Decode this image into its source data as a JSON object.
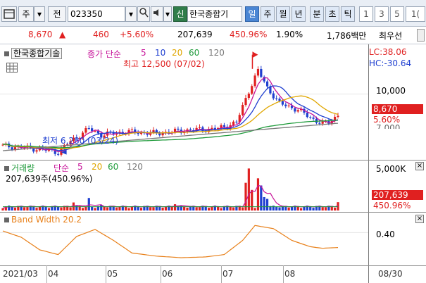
{
  "toolbar": {
    "mode_jong": "주",
    "prev_label": "전",
    "code": "023350",
    "sin_label": "신",
    "stock_name": "한국종합기",
    "periods": [
      "일",
      "주",
      "월",
      "년",
      "분",
      "초",
      "틱"
    ],
    "intervals": [
      "1",
      "3",
      "5",
      "1("
    ]
  },
  "quote": {
    "price": "8,670",
    "change": "460",
    "change_pct": "+5.60%",
    "volume": "207,639",
    "vol_ratio": "450.96%",
    "turnover": "1.90%",
    "amount": "1,786백만",
    "priority": "최우선"
  },
  "price_pane": {
    "title": "한국종합기술",
    "indicator_label": "종가 단순",
    "ma_periods": [
      "5",
      "10",
      "20",
      "60",
      "120"
    ],
    "high_note": "최고 12,500 (07/02)",
    "low_note": "최저 6,280 (03/24)",
    "lc": "LC:38.06",
    "hc": "HC:-30.64",
    "axis_tick": "10,000",
    "price_box": "8,670",
    "pct_box": "5.60%",
    "lower_tick": "7,000"
  },
  "volume_pane": {
    "title": "거래량",
    "ma_label": "단순",
    "ma_periods": [
      "5",
      "20",
      "60",
      "120"
    ],
    "summary": "207,639주(450.96%)",
    "axis_tick": "5,000K",
    "vol_box": "207,639",
    "pct_box": "450.96%"
  },
  "bw_pane": {
    "title": "Band Width 20.2",
    "axis_tick": "0.40"
  },
  "x_axis": {
    "labels": [
      "2021/03",
      "04",
      "05",
      "06",
      "07",
      "08"
    ],
    "right_label": "08/30"
  },
  "colors": {
    "up": "#e02020",
    "down": "#1f3fd0",
    "ma5": "#c7159a",
    "ma10": "#1f3fd0",
    "ma20": "#e0a600",
    "ma60": "#1e9a3a",
    "ma120": "#777777",
    "bw_line": "#e8801a"
  },
  "chart_data": [
    {
      "type": "line",
      "title": "한국종합기술",
      "x": [
        "2021/03",
        "04",
        "05",
        "06",
        "07",
        "08",
        "08/30"
      ],
      "series": [
        {
          "name": "종가",
          "values": [
            6600,
            7700,
            7600,
            7900,
            10500,
            8700,
            8670
          ]
        }
      ],
      "ylim": [
        6000,
        12800
      ],
      "annotations": [
        "최고 12,500 (07/02)",
        "최저 6,280 (03/24)"
      ]
    },
    {
      "type": "bar",
      "title": "거래량",
      "ylabel": "",
      "ylim": [
        0,
        5200000
      ]
    },
    {
      "type": "line",
      "title": "Band Width 20.2",
      "ylim": [
        0.0,
        0.6
      ]
    }
  ]
}
